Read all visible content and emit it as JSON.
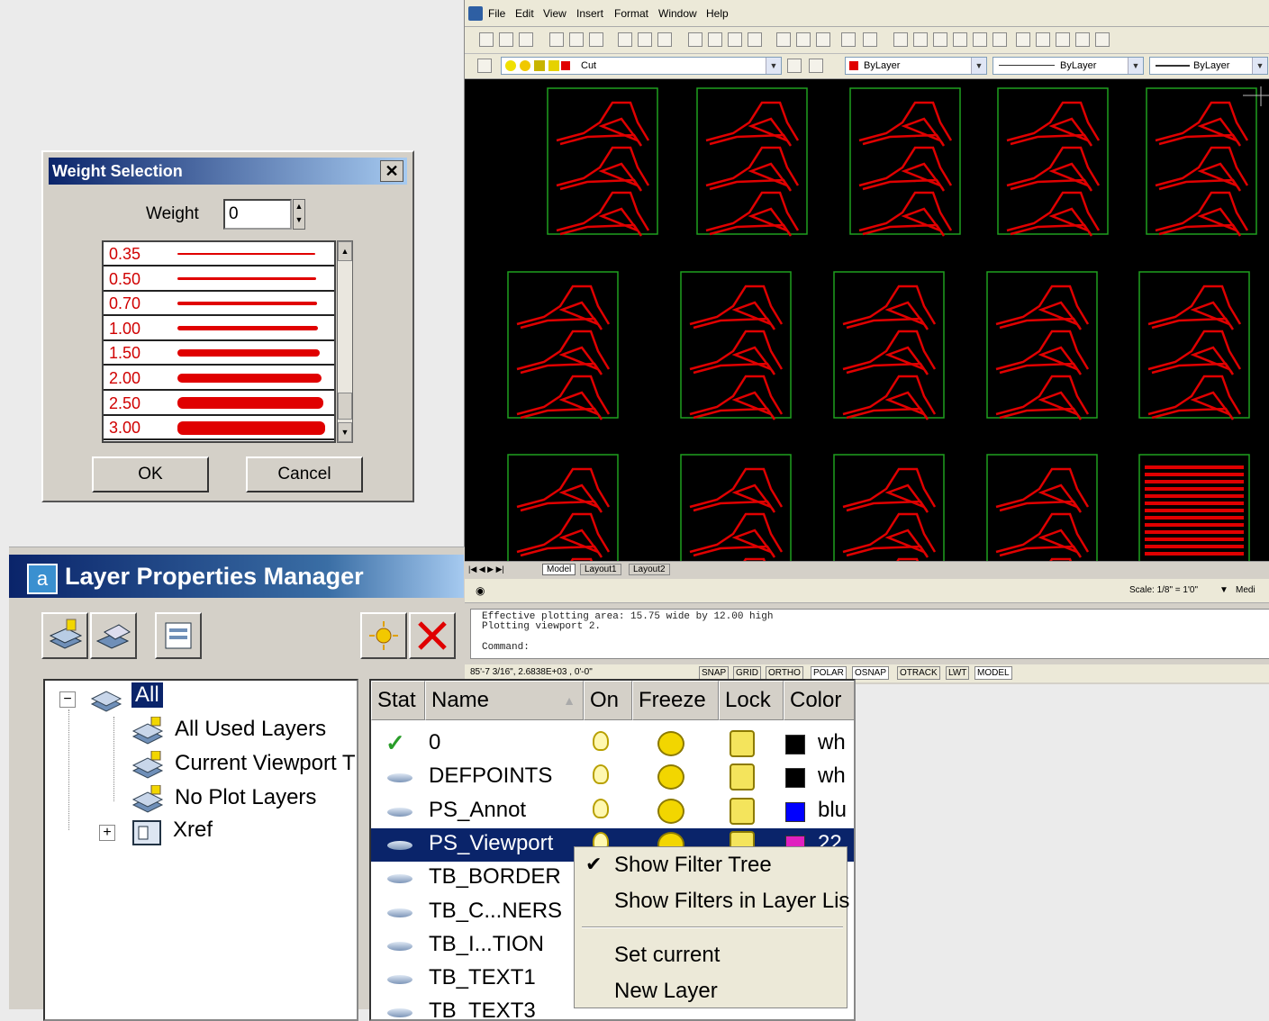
{
  "cad": {
    "menu": [
      "File",
      "Edit",
      "View",
      "Insert",
      "Format",
      "Window",
      "Help"
    ],
    "layer_combo": "Cut",
    "color_combo": "ByLayer",
    "linetype_combo": "ByLayer",
    "lineweight_combo": "ByLayer",
    "tabs": [
      "Model",
      "Layout1",
      "Layout2"
    ],
    "scale": "Scale: 1/8\" = 1'0\"",
    "scale_extra": "Medi",
    "command_lines": [
      "Effective plotting area:  15.75 wide by 12.00 high",
      "Plotting viewport 2.",
      "Command:"
    ],
    "coords": "85'-7 3/16\", 2.6838E+03 , 0'-0\"",
    "status_buttons": [
      "SNAP",
      "GRID",
      "ORTHO",
      "POLAR",
      "OSNAP",
      "OTRACK",
      "LWT",
      "MODEL"
    ],
    "colors": {
      "canvas": "#000000",
      "drawing": "#e00000",
      "frame": "#1f9f1f"
    }
  },
  "weight_dialog": {
    "title": "Weight Selection",
    "close": "✕",
    "weight_label": "Weight",
    "weight_value": "0",
    "items": [
      {
        "label": "0.35",
        "weight": 0.35
      },
      {
        "label": "0.50",
        "weight": 0.5
      },
      {
        "label": "0.70",
        "weight": 0.7
      },
      {
        "label": "1.00",
        "weight": 1.0
      },
      {
        "label": "1.50",
        "weight": 1.5
      },
      {
        "label": "2.00",
        "weight": 2.0
      },
      {
        "label": "2.50",
        "weight": 2.5
      },
      {
        "label": "3.00",
        "weight": 3.0
      }
    ],
    "ok": "OK",
    "cancel": "Cancel"
  },
  "layer_manager": {
    "title": "Layer Properties Manager",
    "tree": {
      "root": "All",
      "children": [
        "All Used Layers",
        "Current Viewport T",
        "No Plot Layers",
        "Xref"
      ]
    },
    "columns": [
      "Stat",
      "Name",
      "On",
      "Freeze",
      "Lock",
      "Color"
    ],
    "layers": [
      {
        "name": "0",
        "color": "wh",
        "swatch": "#000000",
        "current": true
      },
      {
        "name": "DEFPOINTS",
        "color": "wh",
        "swatch": "#000000"
      },
      {
        "name": "PS_Annot",
        "color": "blu",
        "swatch": "#0000ff"
      },
      {
        "name": "PS_Viewport",
        "color": "22",
        "swatch": "#e020c0",
        "selected": true
      },
      {
        "name": "TB_BORDER",
        "color": "",
        "swatch": ""
      },
      {
        "name": "TB_C...NERS",
        "color": "",
        "swatch": ""
      },
      {
        "name": "TB_I...TION",
        "color": "",
        "swatch": ""
      },
      {
        "name": "TB_TEXT1",
        "color": "",
        "swatch": ""
      },
      {
        "name": "TB_TEXT3",
        "color": "",
        "swatch": ""
      }
    ],
    "context_menu": {
      "show_filter_tree": "Show Filter Tree",
      "show_filters_in_list": "Show Filters in Layer Lis",
      "set_current": "Set current",
      "new_layer": "New Layer"
    }
  }
}
